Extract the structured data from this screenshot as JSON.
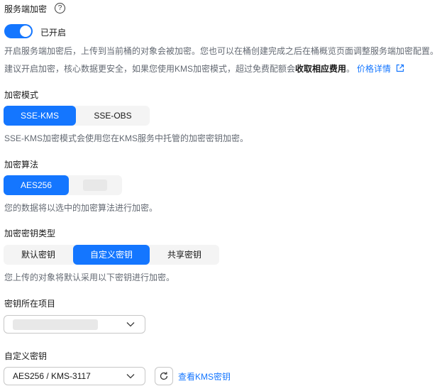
{
  "encryption": {
    "title": "服务端加密",
    "toggle_label": "已开启",
    "desc1": "开启服务端加密后，上传到当前桶的对象会被加密。您也可以在桶创建完成之后在桶概览页面调整服务端加密配置。",
    "desc2_prefix": "建议开启加密，核心数据更安全，如果您使用KMS加密模式，超过免费配额会",
    "desc2_bold": "收取相应费用",
    "desc2_suffix": "。",
    "price_link": "价格详情"
  },
  "mode": {
    "title": "加密模式",
    "options": [
      "SSE-KMS",
      "SSE-OBS"
    ],
    "selected": "SSE-KMS",
    "hint": "SSE-KMS加密模式会使用您在KMS服务中托管的加密密钥加密。"
  },
  "algorithm": {
    "title": "加密算法",
    "options": [
      "AES256"
    ],
    "selected": "AES256",
    "hint": "您的数据将以选中的加密算法进行加密。"
  },
  "key_type": {
    "title": "加密密钥类型",
    "options": [
      "默认密钥",
      "自定义密钥",
      "共享密钥"
    ],
    "selected": "自定义密钥",
    "hint": "您上传的对象将默认采用以下密钥进行加密。"
  },
  "project": {
    "title": "密钥所在项目"
  },
  "custom_key": {
    "title": "自定义密钥",
    "value": "AES256 / KMS-3117",
    "view_link": "查看KMS密钥"
  },
  "colors": {
    "accent": "#1476ff",
    "text": "#191919",
    "hint": "#646a73"
  }
}
